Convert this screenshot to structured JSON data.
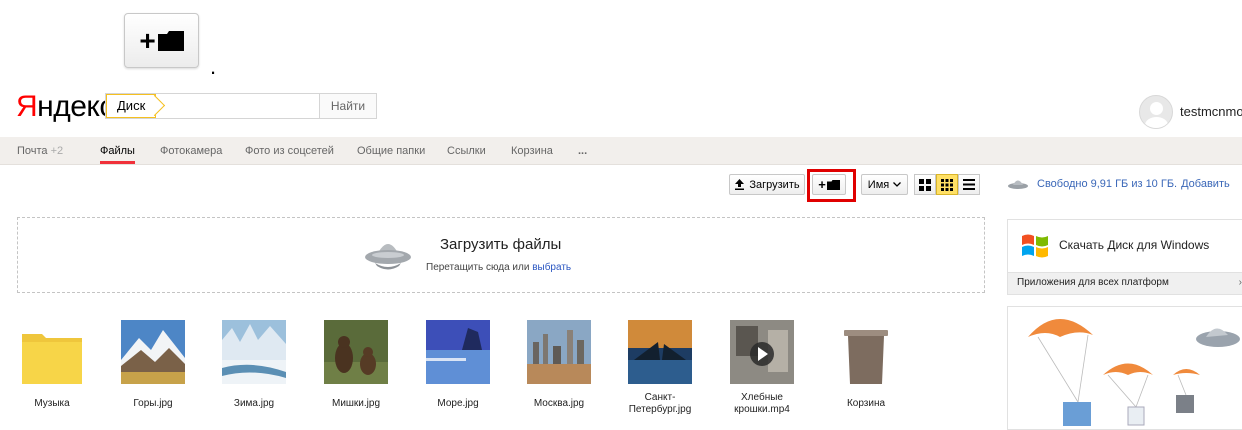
{
  "callout": {
    "marker": "."
  },
  "header": {
    "logo_first": "Я",
    "logo_rest": "ндекс",
    "search_tag": "Диск",
    "search_value": "",
    "search_button": "Найти",
    "username": "testmcnmo"
  },
  "nav": {
    "items": [
      {
        "label": "Почта",
        "count": "+2"
      },
      {
        "label": "Файлы",
        "active": true
      },
      {
        "label": "Фотокамера"
      },
      {
        "label": "Фото из соцсетей"
      },
      {
        "label": "Общие папки"
      },
      {
        "label": "Ссылки"
      },
      {
        "label": "Корзина"
      },
      {
        "label": "..."
      }
    ]
  },
  "toolbar": {
    "upload_label": "Загрузить",
    "new_folder_plus": "+",
    "sort_label": "Имя",
    "view_modes": [
      "large-tiles",
      "small-tiles",
      "list"
    ],
    "active_view": "small-tiles",
    "free_space": "Свободно 9,91 ГБ из 10 ГБ.",
    "add_link": "Добавить"
  },
  "dropzone": {
    "title": "Загрузить файлы",
    "subtitle": "Перетащить сюда или",
    "link": "выбрать"
  },
  "right_panel": {
    "windows_download": "Скачать Диск для Windows",
    "all_platforms": "Приложения для всех платформ",
    "arrow": "›"
  },
  "files": [
    {
      "name": "Музыка",
      "kind": "folder"
    },
    {
      "name": "Горы.jpg",
      "kind": "image"
    },
    {
      "name": "Зима.jpg",
      "kind": "image"
    },
    {
      "name": "Мишки.jpg",
      "kind": "image"
    },
    {
      "name": "Море.jpg",
      "kind": "image"
    },
    {
      "name": "Москва.jpg",
      "kind": "image"
    },
    {
      "name": "Санкт-Петербург.jpg",
      "kind": "image"
    },
    {
      "name": "Хлебные крошки.mp4",
      "kind": "video"
    },
    {
      "name": "Корзина",
      "kind": "trash"
    }
  ],
  "colors": {
    "accent_red": "#f0303a",
    "link_blue": "#2b57c2",
    "folder_yellow": "#f7d548",
    "highlight": "#e00000"
  }
}
